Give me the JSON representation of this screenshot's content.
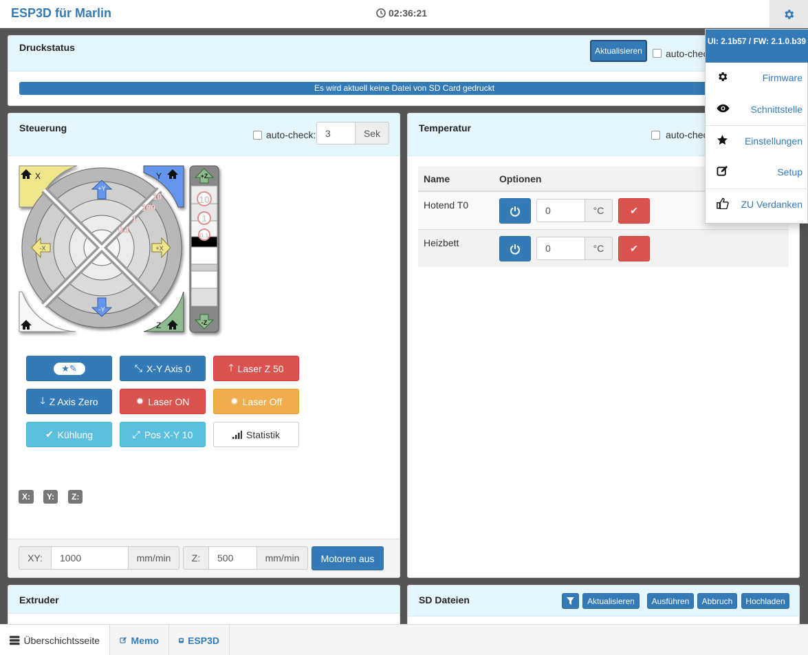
{
  "app": {
    "title": "ESP3D für Marlin",
    "clock": "02:36:21"
  },
  "status_panel": {
    "title": "Druckstatus",
    "refresh_label": "Aktualisieren",
    "autocheck_label": "auto-check",
    "progress_text": "Es wird aktuell keine Datei von SD Card gedruckt"
  },
  "control_panel": {
    "title": "Steuerung",
    "autocheck_label": "auto-check:",
    "interval_value": "3",
    "interval_unit": "Sek",
    "jog": {
      "home_x": "X",
      "home_y": "Y",
      "home_z": "Z",
      "plus_y": "+Y",
      "minus_y": "-Y",
      "plus_x": "+X",
      "minus_x": "-X",
      "plus_z": "+Z",
      "minus_z": "-Z",
      "steps": [
        "10",
        "1",
        "0.1"
      ],
      "ring_labels": [
        "10",
        "100",
        "1",
        "0.1"
      ]
    },
    "macros": [
      {
        "label": "",
        "icon": "star-pencil-icon",
        "style": "primary"
      },
      {
        "label": "X-Y Axis 0",
        "icon": "compress-icon",
        "style": "primary"
      },
      {
        "label": "Laser Z 50",
        "icon": "arrow-up-icon",
        "style": "danger"
      },
      {
        "label": "Z Axis Zero",
        "icon": "arrow-down-icon",
        "style": "primary"
      },
      {
        "label": "Laser ON",
        "icon": "burst-icon",
        "style": "danger"
      },
      {
        "label": "Laser Off",
        "icon": "burst-icon",
        "style": "warning"
      },
      {
        "label": "Kühlung",
        "icon": "check-icon",
        "style": "info"
      },
      {
        "label": "Pos X-Y 10",
        "icon": "expand-icon",
        "style": "info"
      },
      {
        "label": "Statistik",
        "icon": "signal-icon",
        "style": "default"
      }
    ],
    "positions": {
      "x": "X:",
      "y": "Y:",
      "z": "Z:"
    },
    "feed": {
      "xy_label": "XY:",
      "xy_value": "1000",
      "xy_unit": "mm/min",
      "z_label": "Z:",
      "z_value": "500",
      "z_unit": "mm/min",
      "motors_off": "Motoren aus"
    }
  },
  "temp_panel": {
    "title": "Temperatur",
    "autocheck_label": "auto-check",
    "col_name": "Name",
    "col_options": "Optionen",
    "rows": [
      {
        "name": "Hotend T0",
        "value": "0",
        "unit": "°C"
      },
      {
        "name": "Heizbett",
        "value": "0",
        "unit": "°C"
      }
    ]
  },
  "extruder_panel": {
    "title": "Extruder"
  },
  "sd_panel": {
    "title": "SD Dateien",
    "refresh": "Aktualisieren",
    "run": "Ausführen",
    "abort": "Abbruch",
    "upload": "Hochladen"
  },
  "settings_menu": {
    "version": "UI: 2.1b57 / FW: 2.1.0.b39",
    "items": [
      {
        "label": "Firmware",
        "icon": "gear-icon"
      },
      {
        "label": "Schnittstelle",
        "icon": "eye-icon"
      },
      {
        "label": "Einstellungen",
        "icon": "star-icon"
      },
      {
        "label": "Setup",
        "icon": "edit-icon"
      },
      {
        "label": "ZU Verdanken",
        "icon": "thumbs-up-icon"
      }
    ]
  },
  "tabs": [
    {
      "label": "Überschichtsseite",
      "icon": "server-icon",
      "active": true
    },
    {
      "label": "Memo",
      "icon": "edit-icon",
      "active": false
    },
    {
      "label": "ESP3D",
      "icon": "device-icon",
      "active": false
    }
  ],
  "colors": {
    "primary": "#337ab7",
    "danger": "#d9534f",
    "warning": "#f0ad4e",
    "info": "#5bc0de",
    "panel_header": "#e6f6fe"
  }
}
